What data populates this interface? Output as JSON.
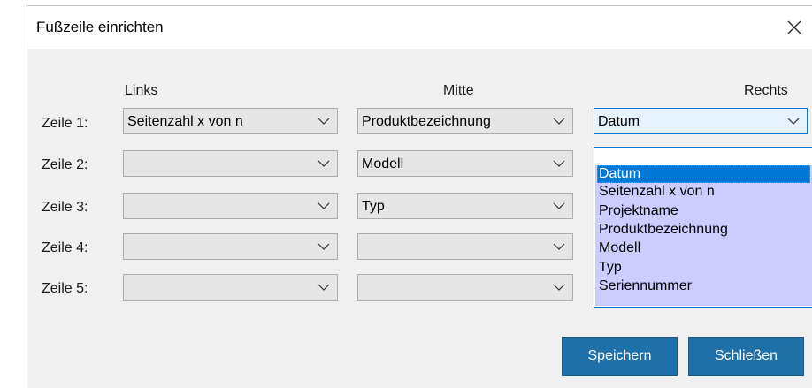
{
  "dialog": {
    "title": "Fußzeile einrichten",
    "close_icon": "close-icon"
  },
  "columns": {
    "left": "Links",
    "middle": "Mitte",
    "right": "Rechts"
  },
  "rows": [
    {
      "label": "Zeile 1:",
      "left": "Seitenzahl x von n",
      "middle": "Produktbezeichnung",
      "right": "Datum"
    },
    {
      "label": "Zeile 2:",
      "left": "",
      "middle": "Modell",
      "right": ""
    },
    {
      "label": "Zeile 3:",
      "left": "",
      "middle": "Typ",
      "right": ""
    },
    {
      "label": "Zeile 4:",
      "left": "",
      "middle": "",
      "right": ""
    },
    {
      "label": "Zeile 5:",
      "left": "",
      "middle": "",
      "right": ""
    }
  ],
  "dropdown_open": {
    "selected": "Datum",
    "options": [
      "Datum",
      "Seitenzahl x von n",
      "Projektname",
      "Produktbezeichnung",
      "Modell",
      "Typ",
      "Seriennummer"
    ]
  },
  "buttons": {
    "save": "Speichern",
    "close": "Schließen"
  },
  "colors": {
    "button_bg": "#1f6fa8",
    "dropdown_bg": "#ccccff",
    "selection": "#0078d7"
  }
}
